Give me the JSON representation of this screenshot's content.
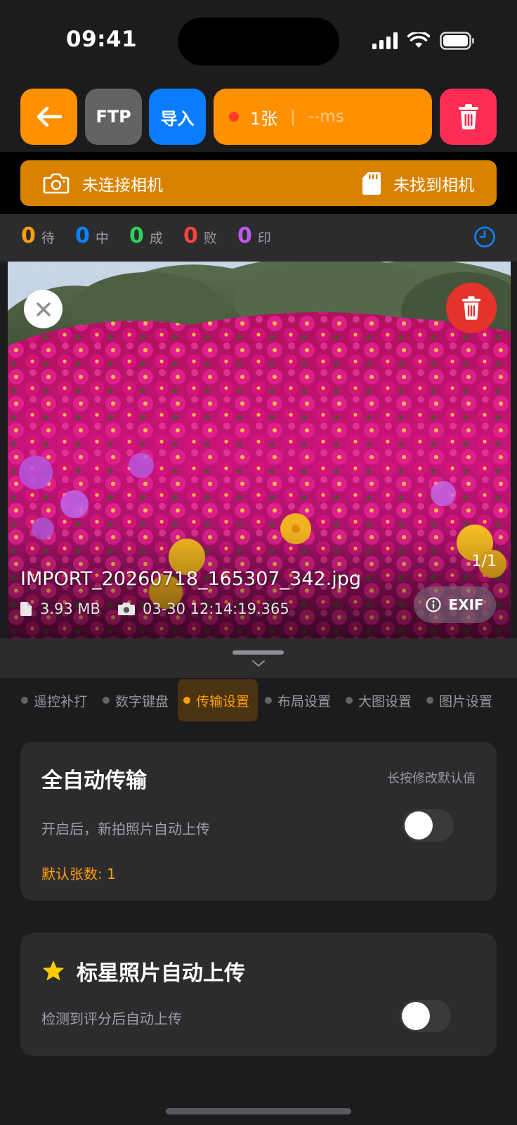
{
  "status": {
    "time": "09:41"
  },
  "toolbar": {
    "back_icon": "arrow-left-icon",
    "ftp_label": "FTP",
    "import_label": "导入",
    "count_label": "1张",
    "separator": "|",
    "latency_label": "--ms",
    "trash_icon": "trash-icon",
    "colors": {
      "back": "#ff9000",
      "ftp": "#636366",
      "import": "#0a7cff",
      "counter": "#ff9000",
      "trash": "#ff2d55"
    }
  },
  "camera_banner": {
    "left_label": "未连接相机",
    "right_label": "未找到相机",
    "color": "#d98200"
  },
  "stats": [
    {
      "num": "0",
      "label": "待",
      "color": "#ff9f0a"
    },
    {
      "num": "0",
      "label": "中",
      "color": "#0a84ff"
    },
    {
      "num": "0",
      "label": "成",
      "color": "#30d158"
    },
    {
      "num": "0",
      "label": "败",
      "color": "#ff453a"
    },
    {
      "num": "0",
      "label": "印",
      "color": "#bf5af2"
    }
  ],
  "photo": {
    "filename": "IMPORT_20260718_165307_342.jpg",
    "size": "3.93 MB",
    "timestamp": "03-30 12:14:19.365",
    "page_indicator": "1/1",
    "exif_label": "EXIF"
  },
  "tabs": [
    {
      "label": "遥控补打",
      "active": false
    },
    {
      "label": "数字键盘",
      "active": false
    },
    {
      "label": "传输设置",
      "active": true
    },
    {
      "label": "布局设置",
      "active": false
    },
    {
      "label": "大图设置",
      "active": false
    },
    {
      "label": "图片设置",
      "active": false
    }
  ],
  "auto_transfer": {
    "title": "全自动传输",
    "hint": "长按修改默认值",
    "description": "开启后，新拍照片自动上传",
    "default_count": "默认张数: 1",
    "enabled": false
  },
  "starred_upload": {
    "title": "标星照片自动上传",
    "description": "检测到评分后自动上传",
    "enabled": false
  }
}
